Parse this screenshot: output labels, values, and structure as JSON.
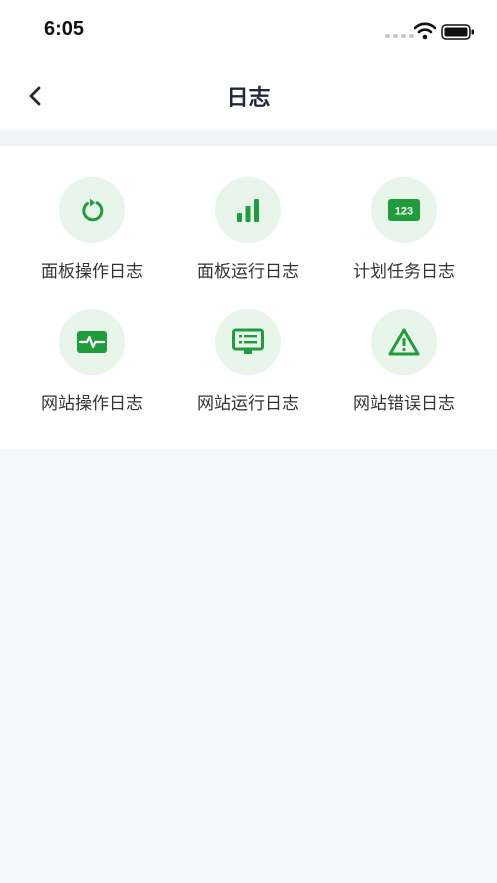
{
  "status_bar": {
    "time": "6:05"
  },
  "nav": {
    "title": "日志"
  },
  "tiles": [
    {
      "label": "面板操作日志",
      "icon": "refresh-icon"
    },
    {
      "label": "面板运行日志",
      "icon": "bar-chart-icon"
    },
    {
      "label": "计划任务日志",
      "icon": "number-badge-icon",
      "badge_text": "123"
    },
    {
      "label": "网站操作日志",
      "icon": "pulse-monitor-icon"
    },
    {
      "label": "网站运行日志",
      "icon": "monitor-list-icon"
    },
    {
      "label": "网站错误日志",
      "icon": "warning-icon"
    }
  ],
  "colors": {
    "accent": "#1f9d3a",
    "icon_bg": "#e7f5ea",
    "page_bg": "#f6f7fb"
  }
}
